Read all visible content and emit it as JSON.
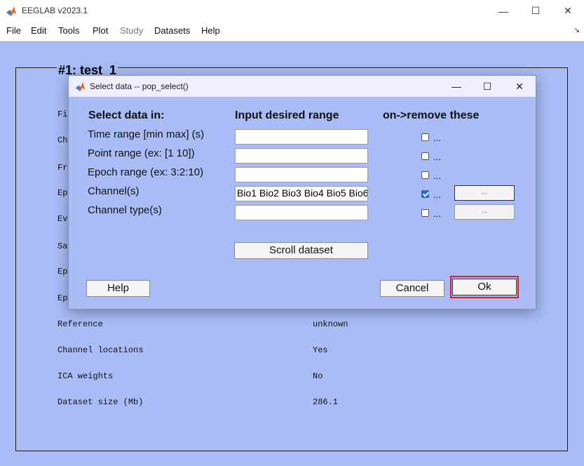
{
  "window": {
    "title": "EEGLAB v2023.1",
    "minimize": "—",
    "maximize": "☐",
    "close": "✕"
  },
  "menubar": {
    "items": [
      "File",
      "Edit",
      "Tools",
      "Plot",
      "Study",
      "Datasets",
      "Help"
    ],
    "resize_glyph": "↘"
  },
  "main": {
    "dataset_title": "#1: test_1",
    "labels": [
      "Fi",
      "Ch",
      "Fr",
      "Ep",
      "Ev",
      "Sa",
      "Ep",
      "Ep",
      "Reference",
      "Channel locations",
      "ICA weights",
      "Dataset size (Mb)"
    ],
    "values": {
      "reference": "unknown",
      "channel_locations": "Yes",
      "ica_weights": "No",
      "dataset_size": "286.1"
    }
  },
  "dialog": {
    "title": "Select data -- pop_select()",
    "minimize": "—",
    "maximize": "☐",
    "close": "✕",
    "headers": {
      "select": "Select data in:",
      "range": "Input desired range",
      "remove": "on->remove these"
    },
    "rows": [
      {
        "label": "Time range [min max] (s)",
        "value": "",
        "checked": false,
        "chk_label": "..."
      },
      {
        "label": "Point range (ex: [1 10])",
        "value": "",
        "checked": false,
        "chk_label": "..."
      },
      {
        "label": "Epoch range (ex: 3:2:10)",
        "value": "",
        "checked": false,
        "chk_label": "..."
      },
      {
        "label": "Channel(s)",
        "value": "Bio1 Bio2 Bio3 Bio4 Bio5 Bio6",
        "checked": true,
        "chk_label": "...",
        "button": "..."
      },
      {
        "label": "Channel type(s)",
        "value": "",
        "checked": false,
        "chk_label": "...",
        "button": "..."
      }
    ],
    "scroll_button": "Scroll dataset",
    "help_button": "Help",
    "cancel_button": "Cancel",
    "ok_button": "Ok"
  },
  "colors": {
    "background": "#a9bcf5",
    "highlight": "#d6202e",
    "checkbox": "#1f6fd1"
  }
}
